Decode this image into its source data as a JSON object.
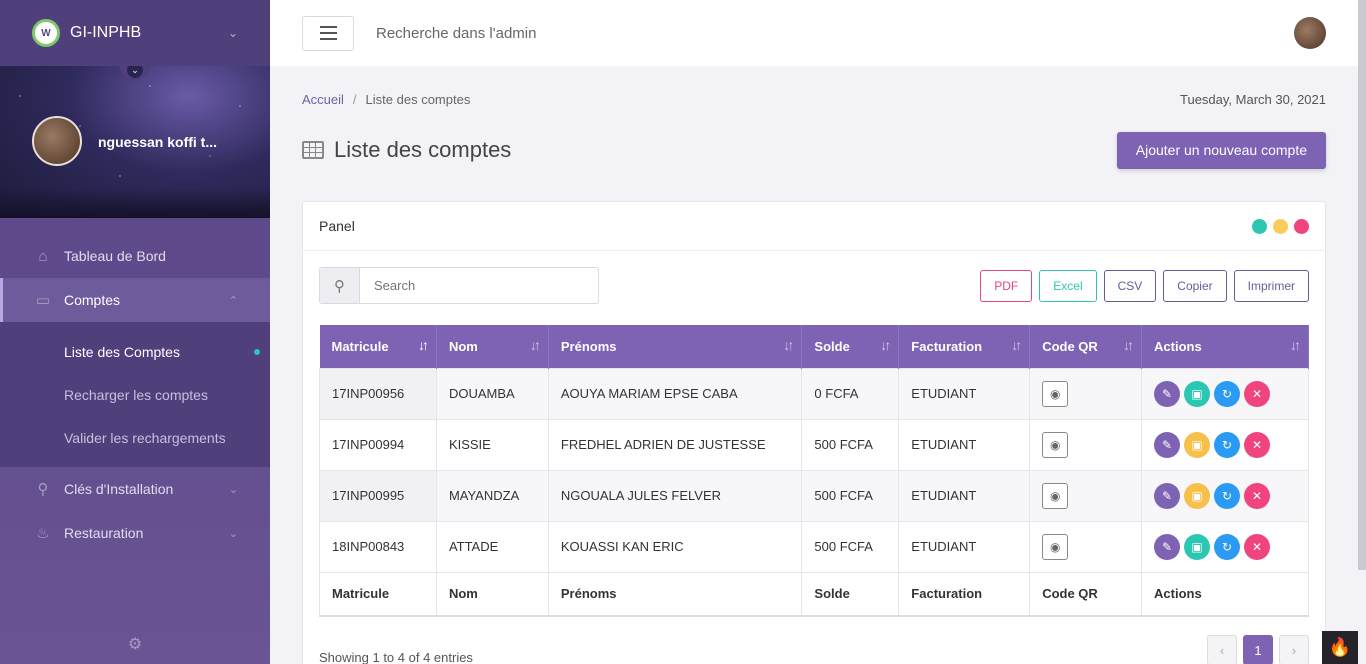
{
  "brand": {
    "name": "GI-INPHB",
    "logo_text": "W"
  },
  "profile": {
    "name": "nguessan koffi t..."
  },
  "sidebar": {
    "items": [
      {
        "label": "Tableau de Bord",
        "icon": "home-icon"
      },
      {
        "label": "Comptes",
        "icon": "money-icon"
      },
      {
        "label": "Clés d'Installation",
        "icon": "key-icon"
      },
      {
        "label": "Restauration",
        "icon": "restaurant-icon"
      }
    ],
    "sub_items": [
      {
        "label": "Liste des Comptes"
      },
      {
        "label": "Recharger les comptes"
      },
      {
        "label": "Valider les rechargements"
      }
    ]
  },
  "topbar": {
    "search_text": "Recherche dans l'admin"
  },
  "breadcrumb": {
    "home": "Accueil",
    "current": "Liste des comptes",
    "date": "Tuesday, March 30, 2021"
  },
  "page": {
    "title": "Liste des comptes",
    "add_button": "Ajouter un nouveau compte"
  },
  "panel": {
    "title": "Panel",
    "dot_colors": [
      "#2cc7b3",
      "#f9cd5b",
      "#f0447f"
    ],
    "search_placeholder": "Search",
    "exports": [
      {
        "label": "PDF",
        "color": "#e7467f"
      },
      {
        "label": "Excel",
        "color": "#2cc7b3"
      },
      {
        "label": "CSV",
        "color": "#6b5a9a"
      },
      {
        "label": "Copier",
        "color": "#6b5a9a"
      },
      {
        "label": "Imprimer",
        "color": "#6b5a9a"
      }
    ]
  },
  "table": {
    "columns": [
      "Matricule",
      "Nom",
      "Prénoms",
      "Solde",
      "Facturation",
      "Code QR",
      "Actions"
    ],
    "rows": [
      {
        "matricule": "17INP00956",
        "nom": "DOUAMBA",
        "prenoms": "AOUYA MARIAM EPSE CABA",
        "solde": "0 FCFA",
        "facturation": "ETUDIANT",
        "locked": false
      },
      {
        "matricule": "17INP00994",
        "nom": "KISSIE",
        "prenoms": "FREDHEL ADRIEN DE JUSTESSE",
        "solde": "500 FCFA",
        "facturation": "ETUDIANT",
        "locked": true
      },
      {
        "matricule": "17INP00995",
        "nom": "MAYANDZA",
        "prenoms": "NGOUALA JULES FELVER",
        "solde": "500 FCFA",
        "facturation": "ETUDIANT",
        "locked": true
      },
      {
        "matricule": "18INP00843",
        "nom": "ATTADE",
        "prenoms": "KOUASSI KAN ERIC",
        "solde": "500 FCFA",
        "facturation": "ETUDIANT",
        "locked": false
      }
    ]
  },
  "pagination": {
    "info": "Showing 1 to 4 of 4 entries",
    "current": "1",
    "prev": "‹",
    "next": "›"
  }
}
